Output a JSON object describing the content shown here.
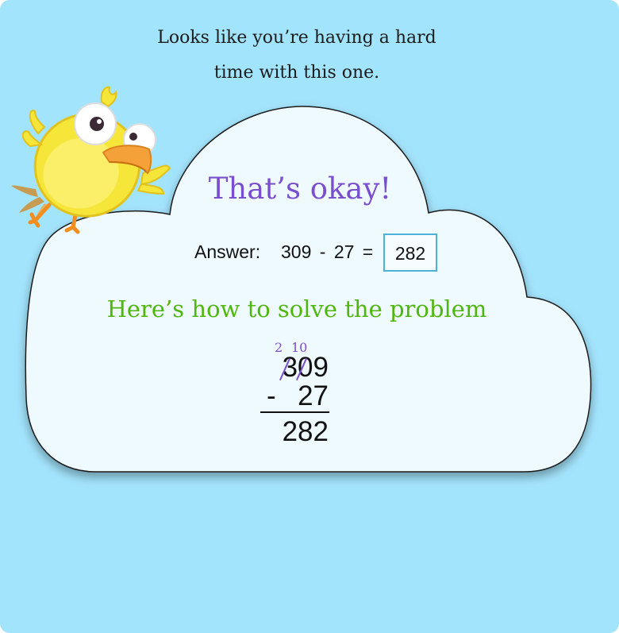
{
  "intro": {
    "line1": "Looks like you’re having a hard",
    "line2": "time with this one."
  },
  "feedback": {
    "heading": "That’s okay!",
    "answer_label": "Answer:",
    "equation": "309 - 27 =",
    "answer_value": "282",
    "subheading": "Here’s how to solve the problem"
  },
  "working": {
    "borrow_hundreds": "2",
    "borrow_tens": "10",
    "top_number": "309",
    "operator": "-",
    "subtrahend": "27",
    "result": "282"
  },
  "colors": {
    "background": "#a3e4fd",
    "cloud": "#eefaff",
    "heading": "#7a4fcf",
    "subheading": "#4fb60e",
    "answer_border": "#4ab4d8"
  }
}
